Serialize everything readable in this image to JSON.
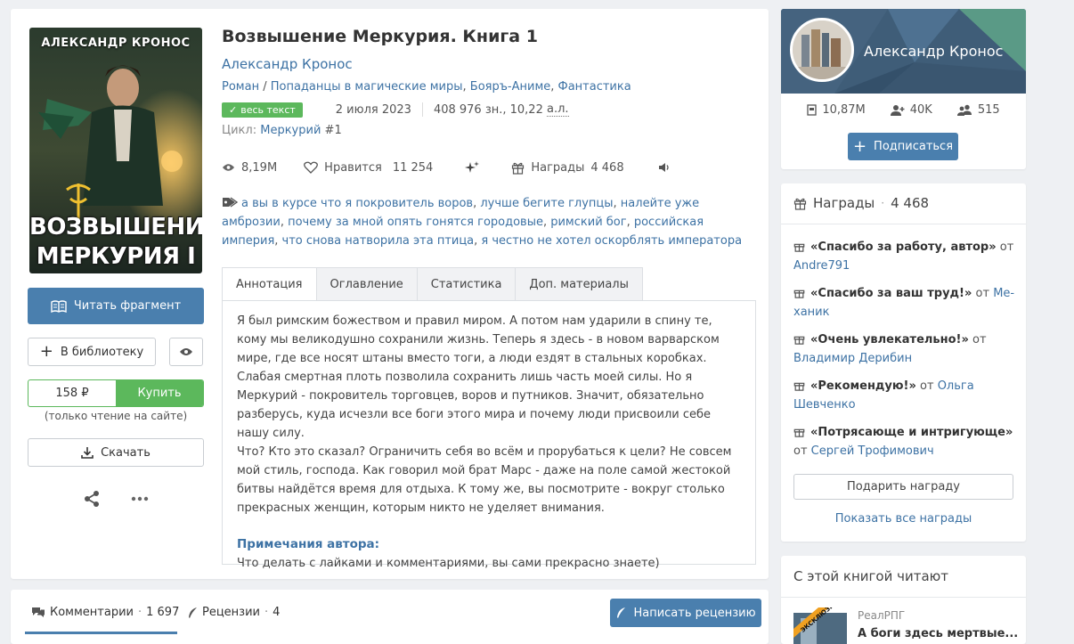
{
  "book": {
    "cover_author": "АЛЕКСАНДР КРОНОС",
    "cover_title_line1": "ВОЗВЫШЕНИЕ",
    "cover_title_line2": "МЕРКУРИЯ I",
    "title": "Возвышение Меркурия. Книга 1",
    "author": "Александр Кронос",
    "genres": [
      "Роман",
      "Попаданцы в магические миры",
      "Бояръ-Аниме",
      "Фантастика"
    ],
    "genre_sep_first": " / ",
    "genre_sep": ", ",
    "badge": "весь текст",
    "date": "2 июля 2023",
    "size": "408 976 зн., 10,22",
    "size_unit": "а.л.",
    "cycle_label": "Цикл:",
    "cycle_name": "Меркурий",
    "cycle_num": "#1",
    "views": "8,19M",
    "likes_label": "Нравится",
    "likes": "11 254",
    "awards_label": "Награды",
    "awards": "4 468",
    "tags": [
      "а вы в курсе что я покровитель воров",
      "лучше бегите глупцы",
      "налейте уже амброзии",
      "почему за мной опять гонятся городовые",
      "римский бог",
      "российская империя",
      "что снова натворила эта птица",
      "я честно не хотел оскорблять императора"
    ]
  },
  "actions": {
    "read_fragment": "Читать фрагмент",
    "add_library": "В библиотеку",
    "price": "158 ₽",
    "buy": "Купить",
    "price_note": "(только чтение на сайте)",
    "download": "Скачать"
  },
  "tabs": [
    "Аннотация",
    "Оглавление",
    "Статистика",
    "Доп. материалы"
  ],
  "annotation": {
    "paragraphs": [
      "Я был римским божеством и правил миром. А потом нам ударили в спину те, кому мы великодушно сохранили жизнь. Теперь я здесь - в новом варварском мире, где все носят штаны вместо тоги, а люди ездят в стальных коробках.",
      "Слабая смертная плоть позволила сохранить лишь часть моей силы. Но я Меркурий - покровитель торговцев, воров и путников. Значит, обязательно разберусь, куда ис­чезли все боги этого мира и почему люди присвоили себе нашу силу.",
      "Что? Кто это сказал? Ограничить себя во всём и прорубаться к цели? Не совсем мой стиль, господа. Как говорил мой брат Марс - даже на поле самой жестокой битвы найдётся время для отдыха. К тому же, вы посмотрите - вокруг столько прекрасных женщин, которым никто не уделяет внимания."
    ],
    "notes_title": "Примечания автора:",
    "notes_text": "Что делать с лайками и комментариями, вы сами прекрасно знаете)"
  },
  "comments_bar": {
    "comments_label": "Комментарии",
    "comments_count": "1 697",
    "reviews_label": "Рецензии",
    "reviews_count": "4",
    "write_review": "Написать рецензию"
  },
  "author_card": {
    "name": "Александр Кронос",
    "reads": "10,87M",
    "followers": "40K",
    "friends": "515",
    "subscribe": "Подписаться"
  },
  "awards_card": {
    "title": "Награды",
    "count": "4 468",
    "from": "от",
    "items": [
      {
        "name": "«Спасибо за работу, автор»",
        "user": "Andre791"
      },
      {
        "name": "«Спасибо за ваш труд!»",
        "user": "Ме­ханик"
      },
      {
        "name": "«Очень увлекательно!»",
        "user": "Владимир Дерибин"
      },
      {
        "name": "«Рекомендую!»",
        "user": "Ольга Шевченко"
      },
      {
        "name": "«Потрясающе и интригующе»",
        "user": "Сергей Трофимович"
      }
    ],
    "gift": "Подарить награду",
    "show_all": "Показать все награды"
  },
  "also_read": {
    "title": "С этой книгой читают",
    "genre": "РеалРПГ",
    "book_title": "А боги здесь мертвые...",
    "badge": "ЭКСКЛЮЗИВ"
  },
  "colors": {
    "primary": "#4a7fae",
    "green": "#5cb85c",
    "link": "#3d72a4",
    "author_banner": "#3f5d78"
  }
}
